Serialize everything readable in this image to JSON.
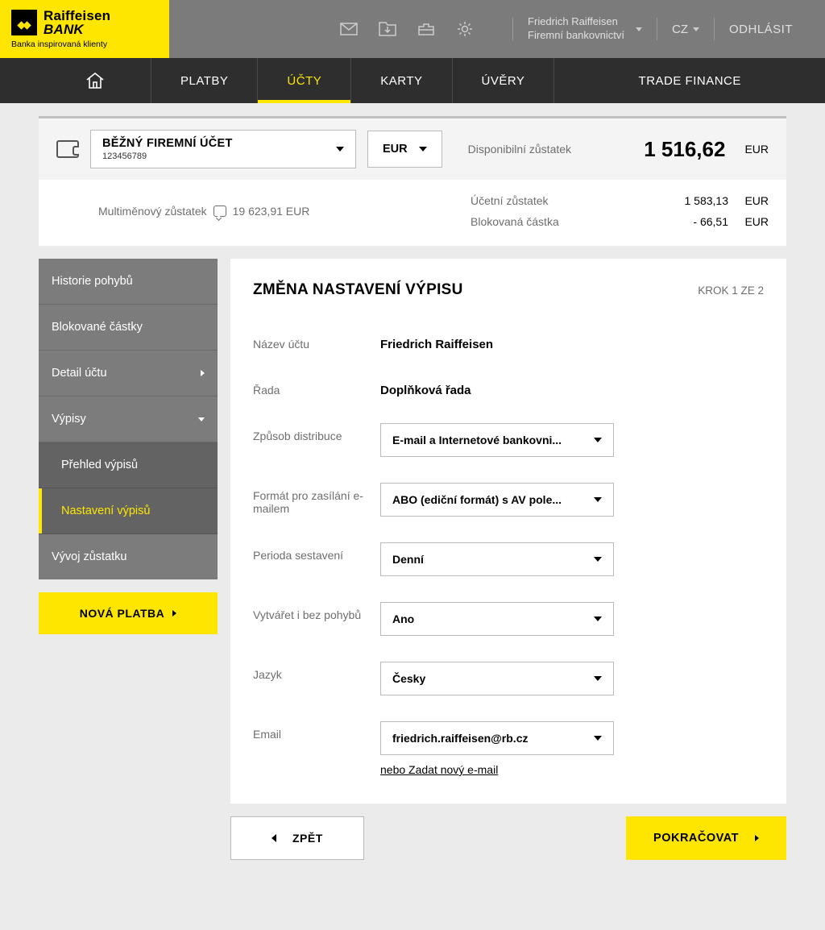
{
  "logo": {
    "line1": "Raiffeisen",
    "line2": "BANK",
    "tagline": "Banka inspirovaná klienty"
  },
  "header": {
    "user_line1": "Friedrich Raiffeisen",
    "user_line2": "Firemní bankovnictví",
    "lang": "CZ",
    "logout": "ODHLÁSIT"
  },
  "nav": {
    "platby": "PLATBY",
    "ucty": "ÚČTY",
    "karty": "KARTY",
    "uvery": "ÚVĚRY",
    "trade": "TRADE FINANCE"
  },
  "account": {
    "name": "BĚŽNÝ FIREMNÍ ÚČET",
    "number": "123456789",
    "currency": "EUR",
    "available_label": "Disponibilní zůstatek",
    "available_value": "1 516,62",
    "available_currency": "EUR",
    "multi_label": "Multiměnový zůstatek",
    "multi_value": "19 623,91 EUR",
    "ledger_label": "Účetní zůstatek",
    "ledger_value": "1 583,13",
    "ledger_currency": "EUR",
    "blocked_label": "Blokovaná částka",
    "blocked_value": "- 66,51",
    "blocked_currency": "EUR"
  },
  "sidebar": {
    "historie": "Historie pohybů",
    "blokovane": "Blokované částky",
    "detail": "Detail účtu",
    "vypisy": "Výpisy",
    "prehled": "Přehled výpisů",
    "nastaveni": "Nastavení výpisů",
    "vyvoj": "Vývoj zůstatku",
    "nova_platba": "NOVÁ PLATBA"
  },
  "panel": {
    "title": "ZMĚNA NASTAVENÍ VÝPISU",
    "step": "KROK 1 ZE 2",
    "fields": {
      "nazev_label": "Název účtu",
      "nazev_value": "Friedrich Raiffeisen",
      "rada_label": "Řada",
      "rada_value": "Doplňková řada",
      "distribuce_label": "Způsob distribuce",
      "distribuce_value": "E-mail a Internetové bankovni...",
      "format_label": "Formát pro zasílání e-mailem",
      "format_value": "ABO (ediční formát) s AV pole...",
      "perioda_label": "Perioda sestavení",
      "perioda_value": "Denní",
      "vytvaret_label": "Vytvářet i bez pohybů",
      "vytvaret_value": "Ano",
      "jazyk_label": "Jazyk",
      "jazyk_value": "Česky",
      "email_label": "Email",
      "email_value": "friedrich.raiffeisen@rb.cz",
      "email_new": "nebo Zadat nový e-mail"
    }
  },
  "actions": {
    "back": "ZPĚT",
    "continue": "POKRAČOVAT"
  }
}
